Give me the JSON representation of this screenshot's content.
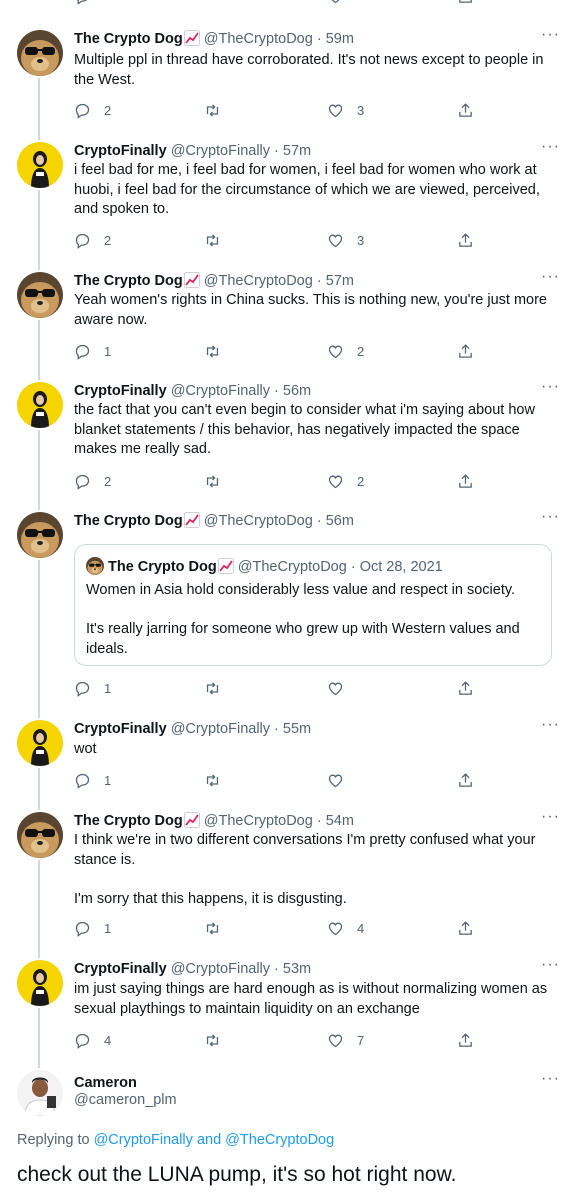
{
  "tweets": [
    {
      "name": "The Crypto Dog",
      "handle": "@TheCryptoDog",
      "time": "59m",
      "text": "Multiple ppl in thread have corroborated. It's not news except to people in the West.",
      "replies": "2",
      "retweets": "",
      "likes": "3"
    },
    {
      "name": "CryptoFinally",
      "handle": "@CryptoFinally",
      "time": "57m",
      "text": "i feel bad for me, i feel bad for women, i feel bad for women who work at huobi, i feel bad for the circumstance of which we are viewed, perceived, and spoken to.",
      "replies": "2",
      "retweets": "",
      "likes": "3"
    },
    {
      "name": "The Crypto Dog",
      "handle": "@TheCryptoDog",
      "time": "57m",
      "text": "Yeah women's rights in China sucks. This is nothing new, you're just more aware now.",
      "replies": "1",
      "retweets": "",
      "likes": "2"
    },
    {
      "name": "CryptoFinally",
      "handle": "@CryptoFinally",
      "time": "56m",
      "text": "the fact that you can't even begin to consider what i'm saying about how blanket statements / this behavior, has negatively impacted the space makes me really sad.",
      "replies": "2",
      "retweets": "",
      "likes": "2"
    },
    {
      "name": "The Crypto Dog",
      "handle": "@TheCryptoDog",
      "time": "56m",
      "text": "",
      "replies": "1",
      "retweets": "",
      "likes": ""
    },
    {
      "name": "CryptoFinally",
      "handle": "@CryptoFinally",
      "time": "55m",
      "text": "wot",
      "replies": "1",
      "retweets": "",
      "likes": ""
    },
    {
      "name": "The Crypto Dog",
      "handle": "@TheCryptoDog",
      "time": "54m",
      "text": "I think we're in two different conversations I'm pretty confused what your stance is.\n\nI'm sorry that this happens, it is disgusting.",
      "replies": "1",
      "retweets": "",
      "likes": "4"
    },
    {
      "name": "CryptoFinally",
      "handle": "@CryptoFinally",
      "time": "53m",
      "text": "im just saying things are hard enough as is without normalizing women as sexual playthings to maintain liquidity on an exchange",
      "replies": "4",
      "retweets": "",
      "likes": "7"
    }
  ],
  "quote": {
    "name": "The Crypto Dog",
    "handle": "@TheCryptoDog",
    "date": "Oct 28, 2021",
    "text": "Women in Asia hold considerably less value and respect in society.\n\nIt's really jarring for someone who grew up with Western values and ideals."
  },
  "main": {
    "name": "Cameron",
    "handle": "@cameron_plm",
    "replying_prefix": "Replying to",
    "replying_user1": "@CryptoFinally",
    "replying_and": "and",
    "replying_user2": "@TheCryptoDog",
    "text": "check out the LUNA pump, it's so hot right now."
  },
  "separator": "·",
  "more_label": "···",
  "colors": {
    "text": "#0f1419",
    "secondary": "#536471",
    "link": "#1d9bf0",
    "border": "#cfd9de",
    "chart_red": "#e0245e"
  },
  "icons": [
    "reply-icon",
    "retweet-icon",
    "like-icon",
    "share-icon",
    "more-icon",
    "chart-increasing-icon"
  ]
}
